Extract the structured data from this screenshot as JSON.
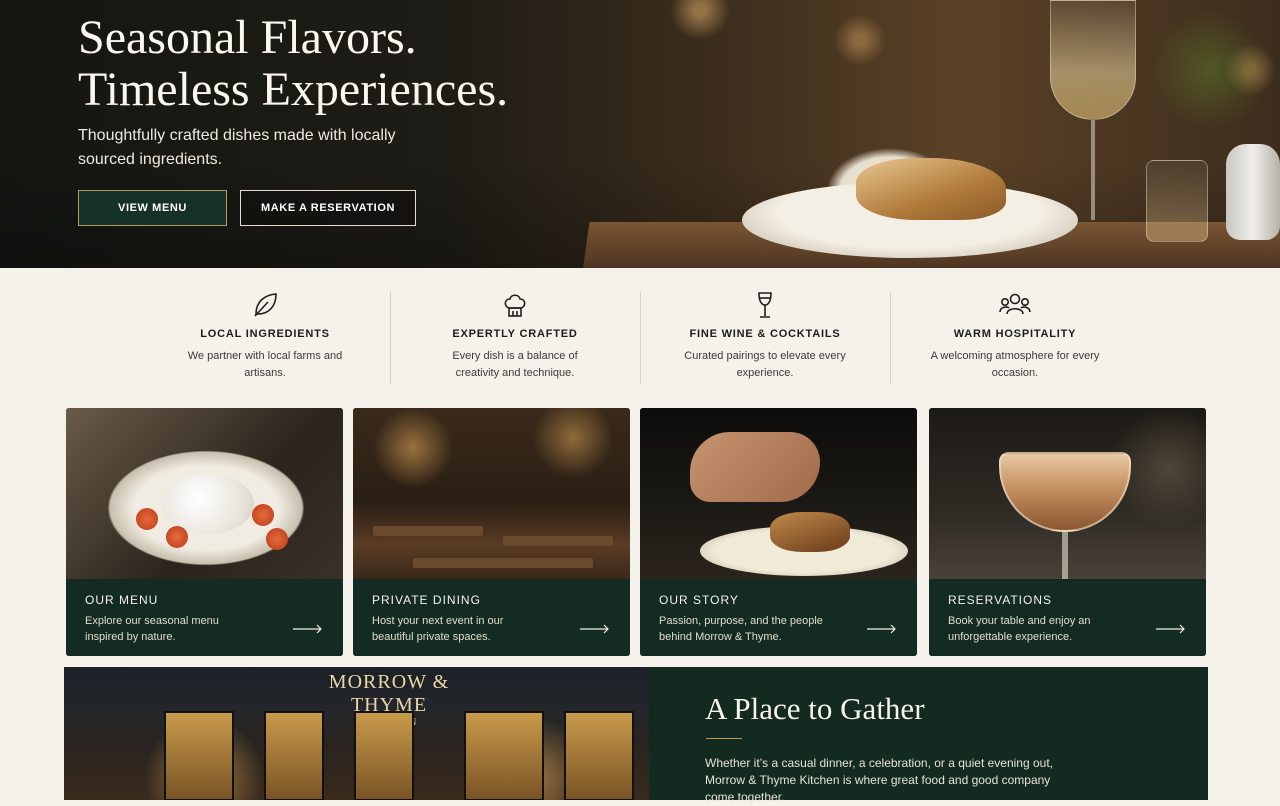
{
  "hero": {
    "title_line1": "Seasonal Flavors.",
    "title_line2": "Timeless Experiences.",
    "subtitle": "Thoughtfully crafted dishes made with locally sourced ingredients.",
    "primary_button": "VIEW MENU",
    "secondary_button": "MAKE A RESERVATION"
  },
  "features": [
    {
      "icon": "leaf-icon",
      "title": "LOCAL INGREDIENTS",
      "text": "We partner with local farms and artisans."
    },
    {
      "icon": "chef-hat-icon",
      "title": "EXPERTLY CRAFTED",
      "text": "Every dish is a balance of creativity and technique."
    },
    {
      "icon": "wine-glass-icon",
      "title": "FINE WINE & COCKTAILS",
      "text": "Curated pairings to elevate every experience."
    },
    {
      "icon": "people-icon",
      "title": "WARM HOSPITALITY",
      "text": "A welcoming atmosphere for every occasion."
    }
  ],
  "cards": [
    {
      "title": "OUR MENU",
      "text": "Explore our seasonal menu inspired by nature."
    },
    {
      "title": "PRIVATE DINING",
      "text": "Host your next event in our beautiful private spaces."
    },
    {
      "title": "OUR STORY",
      "text": "Passion, purpose, and the people behind Morrow & Thyme."
    },
    {
      "title": "RESERVATIONS",
      "text": "Book your table and enjoy an unforgettable experience."
    }
  ],
  "gather": {
    "sign_name": "MORROW & THYME",
    "sign_sub": "KITCHEN",
    "title": "A Place to Gather",
    "text": "Whether it’s a casual dinner, a celebration, or a quiet evening out, Morrow & Thyme Kitchen is where great food and good company come together."
  },
  "colors": {
    "accent_green": "#132b22",
    "gold": "#b99a5c",
    "background": "#f5f2ec"
  }
}
